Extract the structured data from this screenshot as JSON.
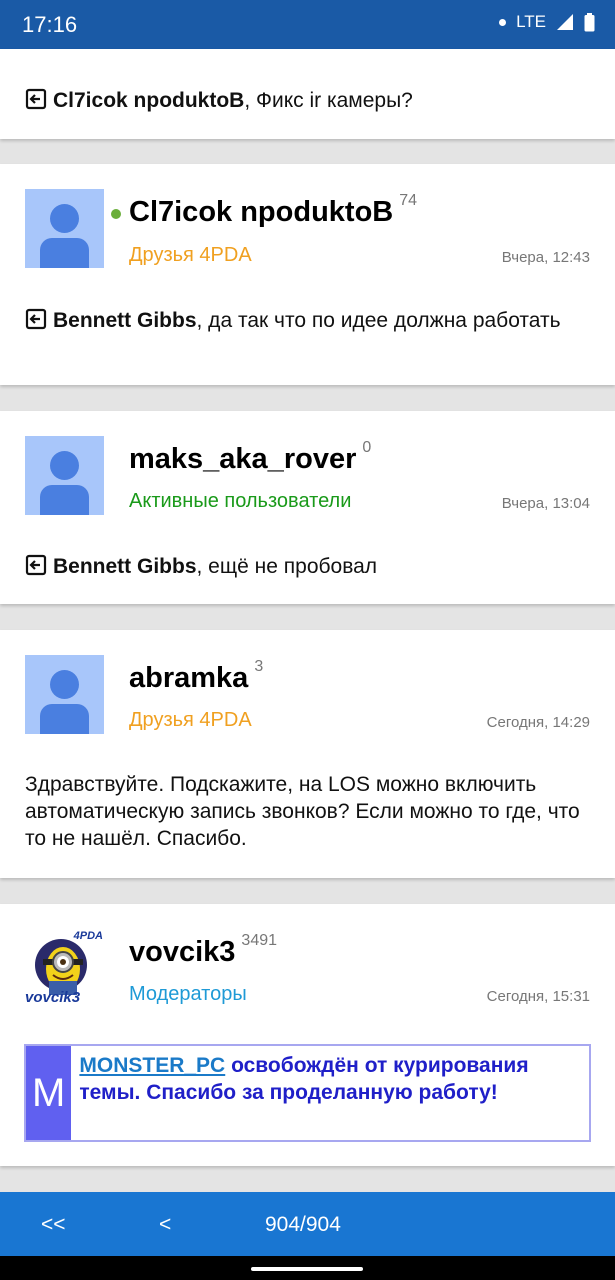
{
  "status": {
    "time": "17:16",
    "network": "LTE"
  },
  "top_post": {
    "quote_user": "Cl7icok npoduktoB",
    "text": ", Фикс ir камеры?"
  },
  "posts": [
    {
      "username": "Cl7icok npoduktoB",
      "rep": "74",
      "online": true,
      "group": "Друзья 4PDA",
      "group_color": "#f0a020",
      "date": "Вчера, 12:43",
      "quote_user": "Bennett Gibbs",
      "text": ", да так что по идее должна работать"
    },
    {
      "username": "maks_aka_rover",
      "rep": "0",
      "group": "Активные пользователи",
      "group_color": "#1a9a1a",
      "date": "Вчера, 13:04",
      "quote_user": "Bennett Gibbs",
      "text": ", ещё не пробовал"
    },
    {
      "username": "abramka",
      "rep": "3",
      "group": "Друзья 4PDA",
      "group_color": "#f0a020",
      "date": "Сегодня, 14:29",
      "text": "Здравствуйте. Подскажите, на LOS можно включить автоматическую запись звонков? Если можно то где, что то не нашёл. Спасибо."
    },
    {
      "username": "vovcik3",
      "rep": "3491",
      "group": "Модераторы",
      "group_color": "#1e9ad6",
      "date": "Сегодня, 15:31",
      "avatar_label_top": "4PDA",
      "avatar_label": "vovcik3",
      "mod_letter": "M",
      "mod_link": "MONSTER_PC",
      "mod_text": " освобождён от курирования темы. Спасибо за проделанную работу!"
    }
  ],
  "pager": {
    "first": "<<",
    "prev": "<",
    "page": "904/904"
  }
}
